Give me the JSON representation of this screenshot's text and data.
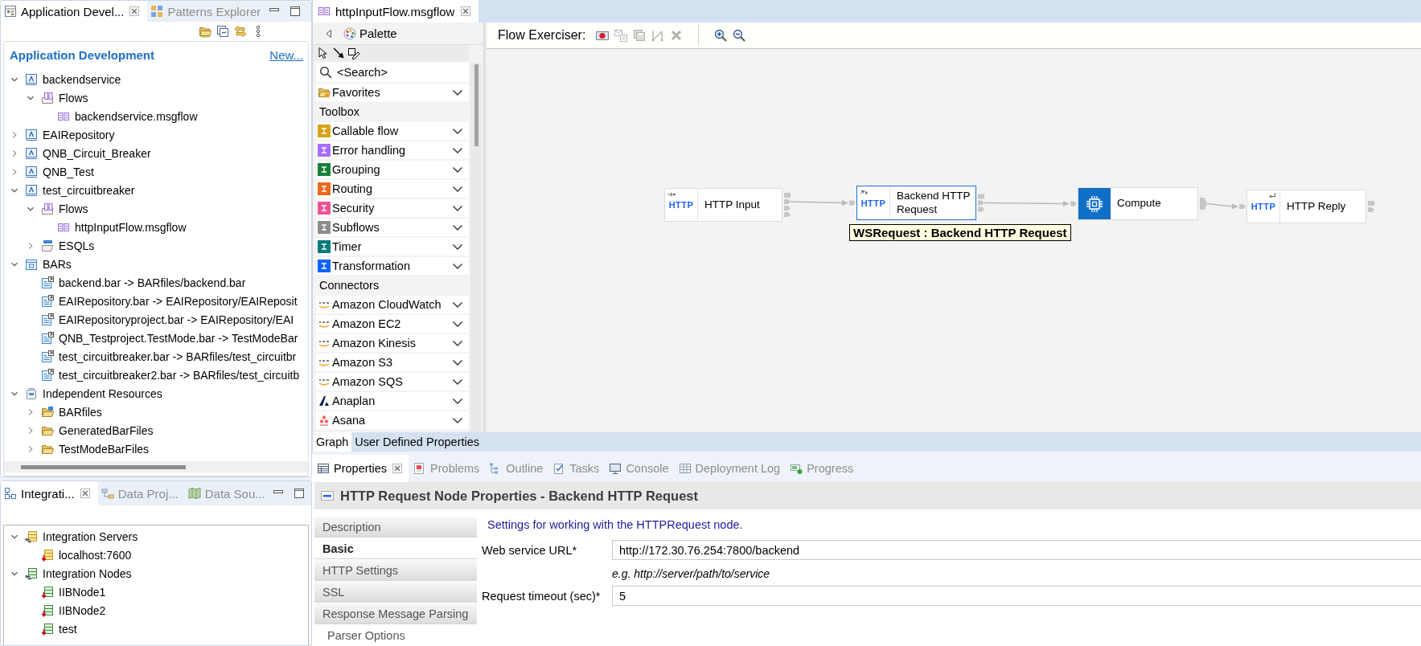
{
  "explorer": {
    "tabs": [
      {
        "label": "Application Devel...",
        "selected": true,
        "closable": true
      },
      {
        "label": "Patterns Explorer",
        "selected": false,
        "closable": false
      }
    ],
    "header": {
      "title": "Application Development",
      "link": "New..."
    },
    "tree": [
      {
        "label": "backendservice",
        "kind": "application",
        "expanded": true,
        "children": [
          {
            "label": "Flows",
            "kind": "flows",
            "expanded": true,
            "children": [
              {
                "label": "backendservice.msgflow",
                "kind": "flow"
              }
            ]
          }
        ]
      },
      {
        "label": "EAIRepository",
        "kind": "application",
        "expanded": false
      },
      {
        "label": "QNB_Circuit_Breaker",
        "kind": "application",
        "expanded": false
      },
      {
        "label": "QNB_Test",
        "kind": "application",
        "expanded": false
      },
      {
        "label": "test_circuitbreaker",
        "kind": "application",
        "expanded": true,
        "children": [
          {
            "label": "Flows",
            "kind": "flows",
            "expanded": true,
            "children": [
              {
                "label": "httpInputFlow.msgflow",
                "kind": "flow"
              }
            ]
          },
          {
            "label": "ESQLs",
            "kind": "esql",
            "expanded": false
          }
        ]
      },
      {
        "label": "BARs",
        "kind": "bars",
        "expanded": true,
        "children": [
          {
            "label": "backend.bar -> BARfiles/backend.bar",
            "kind": "bar"
          },
          {
            "label": "EAIRepository.bar -> EAIRepository/EAIReposit",
            "kind": "bar"
          },
          {
            "label": "EAIRepositoryproject.bar -> EAIRepository/EAI",
            "kind": "bar"
          },
          {
            "label": "QNB_Testproject.TestMode.bar -> TestModeBar",
            "kind": "bar"
          },
          {
            "label": "test_circuitbreaker.bar -> BARfiles/test_circuitbr",
            "kind": "bar"
          },
          {
            "label": "test_circuitbreaker2.bar -> BARfiles/test_circuitb",
            "kind": "bar"
          }
        ]
      },
      {
        "label": "Independent Resources",
        "kind": "project",
        "expanded": true,
        "children": [
          {
            "label": "BARfiles",
            "kind": "barfolder",
            "expanded": false
          },
          {
            "label": "GeneratedBarFiles",
            "kind": "folder",
            "expanded": false
          },
          {
            "label": "TestModeBarFiles",
            "kind": "folder",
            "expanded": false
          }
        ]
      }
    ]
  },
  "integration": {
    "tabs": [
      {
        "label": "Integrati...",
        "selected": true,
        "closable": true
      },
      {
        "label": "Data Proj...",
        "selected": false,
        "closable": false
      },
      {
        "label": "Data Sou...",
        "selected": false,
        "closable": false
      }
    ],
    "tree": [
      {
        "label": "Integration Servers",
        "kind": "servers",
        "expanded": true,
        "children": [
          {
            "label": "localhost:7600",
            "kind": "server"
          }
        ]
      },
      {
        "label": "Integration Nodes",
        "kind": "nodes",
        "expanded": true,
        "children": [
          {
            "label": "IIBNode1",
            "kind": "node"
          },
          {
            "label": "IIBNode2",
            "kind": "node"
          },
          {
            "label": "test",
            "kind": "node"
          }
        ]
      }
    ]
  },
  "editor": {
    "tabs": [
      {
        "label": "httpInputFlow.msgflow",
        "selected": true,
        "closable": true
      }
    ],
    "palette": {
      "title": "Palette",
      "search": {
        "placeholder": "<Search>"
      },
      "items": [
        {
          "kind": "favorites",
          "label": "Favorites"
        },
        {
          "kind": "section",
          "label": "Toolbox"
        },
        {
          "kind": "category",
          "label": "Callable flow",
          "color": "#d8a31a"
        },
        {
          "kind": "category",
          "label": "Error handling",
          "color": "#a56eff"
        },
        {
          "kind": "category",
          "label": "Grouping",
          "color": "#198038"
        },
        {
          "kind": "category",
          "label": "Routing",
          "color": "#eb6a1f"
        },
        {
          "kind": "category",
          "label": "Security",
          "color": "#ee5396"
        },
        {
          "kind": "category",
          "label": "Subflows",
          "color": "#8d8d8d"
        },
        {
          "kind": "category",
          "label": "Timer",
          "color": "#007d79"
        },
        {
          "kind": "category",
          "label": "Transformation",
          "color": "#0f62fe"
        },
        {
          "kind": "section",
          "label": "Connectors"
        },
        {
          "kind": "aws",
          "label": "Amazon CloudWatch"
        },
        {
          "kind": "aws",
          "label": "Amazon EC2"
        },
        {
          "kind": "aws",
          "label": "Amazon Kinesis"
        },
        {
          "kind": "aws",
          "label": "Amazon S3"
        },
        {
          "kind": "aws",
          "label": "Amazon SQS"
        },
        {
          "kind": "anaplan",
          "label": "Anaplan"
        },
        {
          "kind": "asana",
          "label": "Asana"
        }
      ]
    },
    "toolbar": {
      "label": "Flow Exerciser:",
      "exerciser_buttons": [
        {
          "kind": "record",
          "disabled": false
        },
        {
          "kind": "send",
          "disabled": true
        },
        {
          "kind": "save",
          "disabled": true
        },
        {
          "kind": "path",
          "disabled": true
        },
        {
          "kind": "stop",
          "disabled": true
        }
      ],
      "zoom_buttons": [
        {
          "kind": "zoomin",
          "disabled": false
        },
        {
          "kind": "zoomout",
          "disabled": false
        }
      ]
    },
    "canvas": {
      "nodes": [
        {
          "kind": "http_input",
          "icon_text": "HTTP",
          "label": "HTTP Input",
          "selected": false,
          "connected_to_next": true
        },
        {
          "kind": "http_request",
          "icon_text": "HTTP",
          "label": "Backend HTTP Request",
          "selected": true,
          "connected_to_next": true
        },
        {
          "kind": "compute",
          "label": "Compute",
          "selected": false,
          "connected_to_next": true
        },
        {
          "kind": "http_reply",
          "icon_text": "HTTP",
          "label": "HTTP Reply",
          "selected": false,
          "connected_to_next": false
        }
      ],
      "tooltip": "WSRequest : Backend HTTP Request"
    },
    "bottom_tabs": [
      {
        "label": "Graph",
        "selected": true
      },
      {
        "label": "User Defined Properties",
        "selected": false
      }
    ]
  },
  "properties": {
    "tabs": [
      {
        "label": "Properties",
        "selected": true,
        "closable": true
      },
      {
        "label": "Problems",
        "selected": false,
        "closable": false
      },
      {
        "label": "Outline",
        "selected": false,
        "closable": false
      },
      {
        "label": "Tasks",
        "selected": false,
        "closable": false
      },
      {
        "label": "Console",
        "selected": false,
        "closable": false
      },
      {
        "label": "Deployment Log",
        "selected": false,
        "closable": false
      },
      {
        "label": "Progress",
        "selected": false,
        "closable": false
      }
    ],
    "title": "HTTP Request Node Properties - Backend HTTP Request",
    "nav": [
      {
        "kind": "tab",
        "label": "Description",
        "selected": false
      },
      {
        "kind": "tab",
        "label": "Basic",
        "selected": true
      },
      {
        "kind": "tab",
        "label": "HTTP Settings",
        "selected": false
      },
      {
        "kind": "tab",
        "label": "SSL",
        "selected": false
      },
      {
        "kind": "tab",
        "label": "Response Message Parsing",
        "selected": false
      },
      {
        "kind": "subtab",
        "label": "Parser Options",
        "selected": false
      }
    ],
    "description": "Settings for working with the HTTPRequest node.",
    "fields": [
      {
        "label": "Web service URL*",
        "value": "http://172.30.76.254:7800/backend",
        "hint": "e.g. http://server/path/to/service"
      },
      {
        "label": "Request timeout (sec)*",
        "value": "5"
      }
    ]
  }
}
